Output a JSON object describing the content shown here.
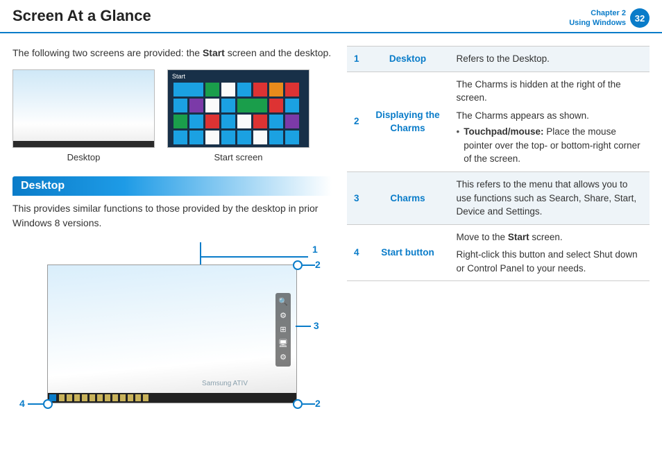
{
  "header": {
    "title": "Screen At a Glance",
    "chapter_line1": "Chapter 2",
    "chapter_line2": "Using Windows",
    "page": "32"
  },
  "intro": {
    "pre": "The following two screens are provided: the ",
    "bold": "Start",
    "post": " screen and the desktop."
  },
  "thumbs": {
    "desktop_caption": "Desktop",
    "start_caption": "Start screen",
    "start_label": "Start",
    "brand": "Samsung ATIV"
  },
  "section": {
    "heading": "Desktop",
    "text": "This provides similar functions to those provided by the desktop in prior Windows 8 versions."
  },
  "callouts": {
    "c1": "1",
    "c2": "2",
    "c3": "3",
    "c4": "4"
  },
  "table": {
    "rows": [
      {
        "num": "1",
        "term": "Desktop",
        "desc_plain": "Refers to the Desktop."
      },
      {
        "num": "2",
        "term": "Displaying the Charms",
        "line1": "The Charms is hidden at the right of the screen.",
        "line2": "The Charms appears as shown.",
        "bullet_bold": "Touchpad/mouse:",
        "bullet_rest": " Place the mouse pointer over the top- or bottom-right corner of the screen."
      },
      {
        "num": "3",
        "term": "Charms",
        "desc_plain": "This refers to the menu that allows you to use functions such as Search, Share, Start, Device and Settings."
      },
      {
        "num": "4",
        "term": "Start button",
        "line1_pre": "Move to the ",
        "line1_bold": "Start",
        "line1_post": " screen.",
        "line2": "Right-click this button and select Shut down or Control Panel to your needs."
      }
    ]
  }
}
